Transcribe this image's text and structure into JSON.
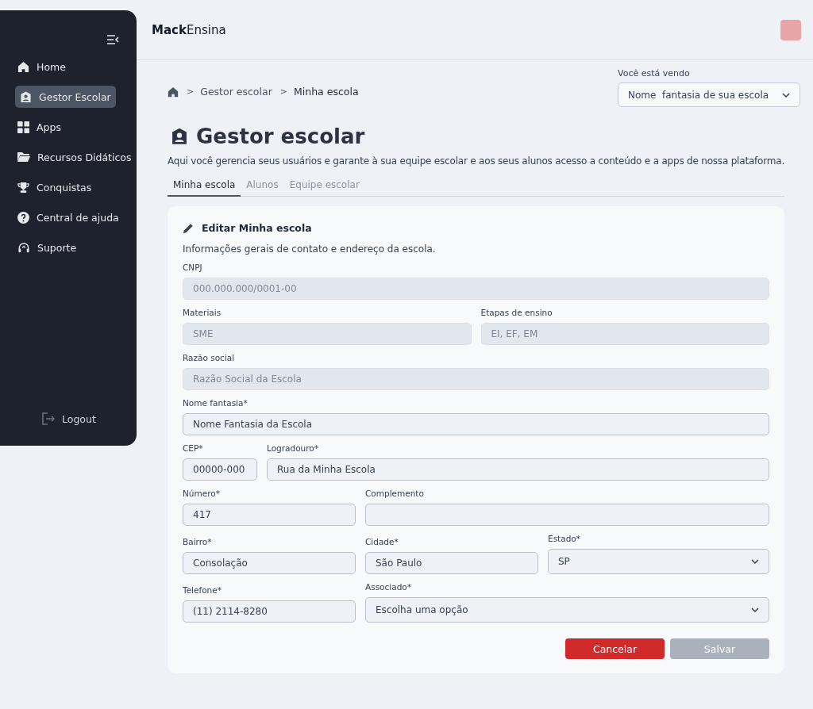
{
  "sidebar": {
    "items": [
      {
        "label": "Home",
        "selected": false
      },
      {
        "label": "Gestor Escolar",
        "selected": true
      },
      {
        "label": "Apps",
        "selected": false
      },
      {
        "label": "Recursos Didáticos",
        "selected": false
      },
      {
        "label": "Conquistas",
        "selected": false
      },
      {
        "label": "Central de ajuda",
        "selected": false
      },
      {
        "label": "Suporte",
        "selected": false
      }
    ],
    "logout": "Logout"
  },
  "header": {
    "logo_bold": "Mack",
    "logo_rest": "Ensina"
  },
  "breadcrumb": [
    "Gestor escolar",
    "Minha escola"
  ],
  "breadcrumb_separator": ">",
  "school_select": {
    "label": "Você está vendo",
    "value": "Nome  fantasia de sua escola"
  },
  "page": {
    "title": "Gestor escolar",
    "description": "Aqui você gerencia seus usuários e garante à sua equipe escolar e aos seus alunos acesso a conteúdo e a apps de nossa plataforma."
  },
  "tabs": [
    {
      "label": "Minha escola",
      "selected": true
    },
    {
      "label": "Alunos",
      "selected": false
    },
    {
      "label": "Equipe escolar",
      "selected": false
    }
  ],
  "form": {
    "title": "Editar Minha escola",
    "subtitle": "Informações gerais de contato e endereço da escola.",
    "rows": [
      [
        {
          "label": "CNPJ",
          "value": "000.000.000/0001-00",
          "disabled": true,
          "kind": "text"
        }
      ],
      [
        {
          "label": "Materiais",
          "value": "SME",
          "disabled": true,
          "kind": "text"
        },
        {
          "label": "Etapas de ensino",
          "value": "EI, EF, EM",
          "disabled": true,
          "kind": "text"
        }
      ],
      [
        {
          "label": "Razão social",
          "value": "Razão Social da Escola",
          "disabled": true,
          "kind": "text"
        }
      ],
      [
        {
          "label": "Nome fantasia*",
          "value": "Nome Fantasia da Escola",
          "disabled": false,
          "kind": "text"
        }
      ],
      [
        {
          "label": "CEP*",
          "value": "00000-000",
          "disabled": false,
          "kind": "text"
        },
        {
          "label": "Logradouro*",
          "value": "Rua da Minha Escola",
          "disabled": false,
          "kind": "text"
        }
      ],
      [
        {
          "label": "Número*",
          "value": "417",
          "disabled": false,
          "kind": "text"
        },
        {
          "label": "Complemento",
          "disabled": false,
          "kind": "text"
        }
      ],
      [
        {
          "label": "Bairro*",
          "value": "Consolação",
          "disabled": false,
          "kind": "text"
        },
        {
          "label": "Cidade*",
          "value": "São Paulo",
          "disabled": false,
          "kind": "text"
        },
        {
          "label": "Estado*",
          "value": "SP",
          "disabled": false,
          "kind": "select"
        }
      ],
      [
        {
          "label": "Telefone*",
          "value": "(11) 2114-8280",
          "disabled": false,
          "kind": "text"
        },
        {
          "label": "Associado*",
          "value": "Escolha uma opção",
          "disabled": false,
          "kind": "select"
        }
      ]
    ],
    "buttons": [
      {
        "label": "Cancelar",
        "kind": "danger",
        "disabled": false
      },
      {
        "label": "Salvar",
        "kind": "primary",
        "disabled": true
      }
    ]
  }
}
